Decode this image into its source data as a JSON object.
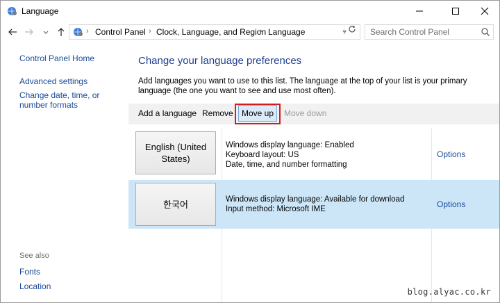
{
  "window": {
    "title": "Language",
    "app_icon": "control-panel-icon"
  },
  "nav": {
    "breadcrumbs": [
      "Control Panel",
      "Clock, Language, and Region",
      "Language"
    ],
    "search_placeholder": "Search Control Panel"
  },
  "sidebar": {
    "links": [
      {
        "label": "Control Panel Home"
      },
      {
        "label": "Advanced settings"
      },
      {
        "label": "Change date, time, or number formats"
      }
    ],
    "see_also_label": "See also",
    "see_also_links": [
      {
        "label": "Fonts"
      },
      {
        "label": "Location"
      }
    ]
  },
  "main": {
    "heading": "Change your language preferences",
    "description": "Add languages you want to use to this list. The language at the top of your list is your primary language (the one you want to see and use most often).",
    "toolbar": {
      "add_label": "Add a language",
      "remove_label": "Remove",
      "move_up_label": "Move up",
      "move_down_label": "Move down"
    },
    "languages": [
      {
        "name": "English (United States)",
        "details": [
          "Windows display language: Enabled",
          "Keyboard layout: US",
          "Date, time, and number formatting"
        ],
        "options_label": "Options",
        "selected": false
      },
      {
        "name": "한국어",
        "details": [
          "Windows display language: Available for download",
          "Input method: Microsoft IME"
        ],
        "options_label": "Options",
        "selected": true
      }
    ]
  },
  "watermark": "blog.alyac.co.kr",
  "colors": {
    "link": "#1a4a9a",
    "selected_row": "#cce6f8",
    "highlight_box": "#d21d1d",
    "heading": "#1f3f8f"
  }
}
